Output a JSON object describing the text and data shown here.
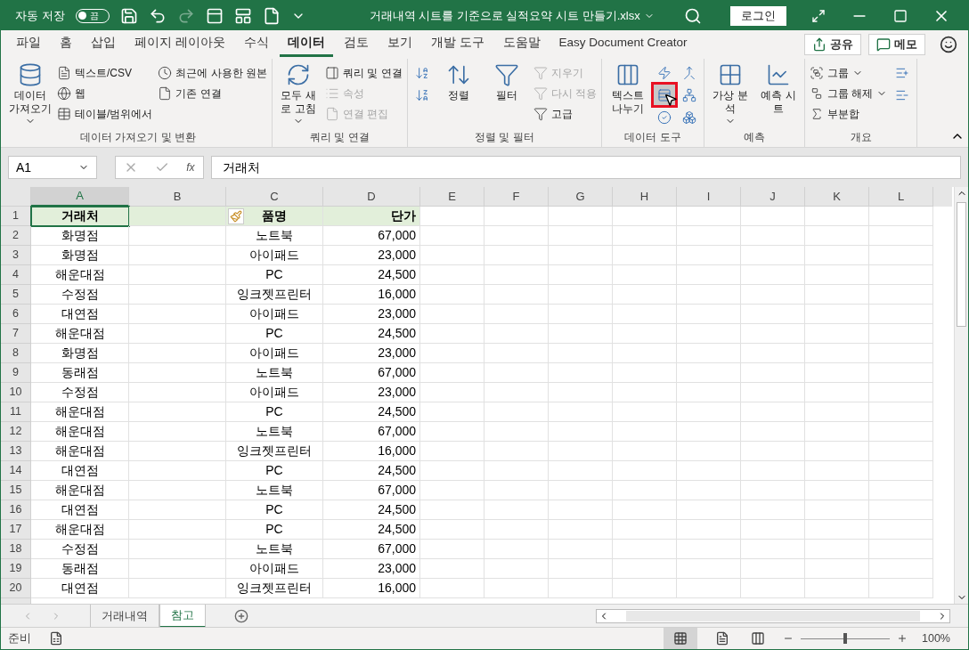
{
  "title_bar": {
    "autosave_label": "자동 저장",
    "autosave_on": false,
    "autosave_state": "끔",
    "title": "거래내역 시트를 기준으로 실적요약 시트 만들기.xlsx",
    "login": "로그인"
  },
  "ribbon_tabs": [
    {
      "label": "파일",
      "selected": false
    },
    {
      "label": "홈",
      "selected": false
    },
    {
      "label": "삽입",
      "selected": false
    },
    {
      "label": "페이지 레이아웃",
      "selected": false
    },
    {
      "label": "수식",
      "selected": false
    },
    {
      "label": "데이터",
      "selected": true
    },
    {
      "label": "검토",
      "selected": false
    },
    {
      "label": "보기",
      "selected": false
    },
    {
      "label": "개발 도구",
      "selected": false
    },
    {
      "label": "도움말",
      "selected": false
    },
    {
      "label": "Easy Document Creator",
      "selected": false
    }
  ],
  "share_button": "공유",
  "memo_button": "메모",
  "ribbon_groups": [
    {
      "label": "데이터 가져오기 및 변환",
      "items": [
        {
          "kind": "large",
          "label": "데이터 가져오기",
          "dropdown": true
        },
        {
          "kind": "column",
          "items": [
            {
              "label": "텍스트/CSV",
              "disabled": false
            },
            {
              "label": "웹",
              "disabled": false
            },
            {
              "label": "테이블/범위에서",
              "disabled": false
            }
          ]
        },
        {
          "kind": "column",
          "items": [
            {
              "label": "최근에 사용한 원본",
              "disabled": false
            },
            {
              "label": "기존 연결",
              "disabled": false
            }
          ]
        }
      ]
    },
    {
      "label": "쿼리 및 연결",
      "items": [
        {
          "kind": "large",
          "label": "모두 새로 고침",
          "dropdown": true
        },
        {
          "kind": "column",
          "items": [
            {
              "label": "쿼리 및 연결",
              "disabled": false
            },
            {
              "label": "속성",
              "disabled": true
            },
            {
              "label": "연결 편집",
              "disabled": true
            }
          ]
        }
      ]
    },
    {
      "label": "정렬 및 필터",
      "items": [
        {
          "kind": "icons",
          "icons": [
            {
              "highlighted": false
            },
            {
              "highlighted": false
            }
          ]
        },
        {
          "kind": "large",
          "label": "정렬",
          "dropdown": false
        },
        {
          "kind": "large",
          "label": "필터",
          "dropdown": false
        },
        {
          "kind": "column",
          "items": [
            {
              "label": "지우기",
              "disabled": true
            },
            {
              "label": "다시 적용",
              "disabled": true
            },
            {
              "label": "고급",
              "disabled": false
            }
          ]
        }
      ]
    },
    {
      "label": "데이터 도구",
      "items": [
        {
          "kind": "large",
          "label": "텍스트 나누기",
          "dropdown": false
        },
        {
          "kind": "icons",
          "icons": [
            {
              "highlighted": false
            },
            {
              "highlighted": true
            },
            {
              "highlighted": false
            }
          ]
        },
        {
          "kind": "icons",
          "icons": [
            {
              "highlighted": false
            },
            {
              "highlighted": false
            },
            {
              "highlighted": false
            }
          ]
        }
      ]
    },
    {
      "label": "예측",
      "items": [
        {
          "kind": "large",
          "label": "가상 분석",
          "dropdown": true
        },
        {
          "kind": "large",
          "label": "예측 시트",
          "dropdown": false
        }
      ]
    },
    {
      "label": "개요",
      "items": [
        {
          "kind": "column",
          "items": [
            {
              "label": "그룹",
              "disabled": false,
              "dropdown": true
            },
            {
              "label": "그룹 해제",
              "disabled": false,
              "dropdown": true
            },
            {
              "label": "부분합",
              "disabled": false,
              "dropdown": false
            }
          ]
        },
        {
          "kind": "icons",
          "icons": [
            {
              "highlighted": false
            },
            {
              "highlighted": false
            }
          ]
        }
      ]
    }
  ],
  "formula_bar": {
    "name_box": "A1",
    "function_label": "fx",
    "formula": "거래처"
  },
  "columns": [
    {
      "label": "A",
      "selected": true
    },
    {
      "label": "B",
      "selected": false
    },
    {
      "label": "C",
      "selected": false
    },
    {
      "label": "D",
      "selected": false
    },
    {
      "label": "E",
      "selected": false
    },
    {
      "label": "F",
      "selected": false
    },
    {
      "label": "G",
      "selected": false
    },
    {
      "label": "H",
      "selected": false
    },
    {
      "label": "I",
      "selected": false
    },
    {
      "label": "J",
      "selected": false
    },
    {
      "label": "K",
      "selected": false
    },
    {
      "label": "L",
      "selected": false
    }
  ],
  "rows": [
    {
      "number": "1",
      "header": true,
      "cells": [
        "거래처",
        "",
        "품명",
        "단가"
      ]
    },
    {
      "number": "2",
      "header": false,
      "cells": [
        "화명점",
        "",
        "노트북",
        "67,000"
      ]
    },
    {
      "number": "3",
      "header": false,
      "cells": [
        "화명점",
        "",
        "아이패드",
        "23,000"
      ]
    },
    {
      "number": "4",
      "header": false,
      "cells": [
        "해운대점",
        "",
        "PC",
        "24,500"
      ]
    },
    {
      "number": "5",
      "header": false,
      "cells": [
        "수정점",
        "",
        "잉크젯프린터",
        "16,000"
      ]
    },
    {
      "number": "6",
      "header": false,
      "cells": [
        "대연점",
        "",
        "아이패드",
        "23,000"
      ]
    },
    {
      "number": "7",
      "header": false,
      "cells": [
        "해운대점",
        "",
        "PC",
        "24,500"
      ]
    },
    {
      "number": "8",
      "header": false,
      "cells": [
        "화명점",
        "",
        "아이패드",
        "23,000"
      ]
    },
    {
      "number": "9",
      "header": false,
      "cells": [
        "동래점",
        "",
        "노트북",
        "67,000"
      ]
    },
    {
      "number": "10",
      "header": false,
      "cells": [
        "수정점",
        "",
        "아이패드",
        "23,000"
      ]
    },
    {
      "number": "11",
      "header": false,
      "cells": [
        "해운대점",
        "",
        "PC",
        "24,500"
      ]
    },
    {
      "number": "12",
      "header": false,
      "cells": [
        "해운대점",
        "",
        "노트북",
        "67,000"
      ]
    },
    {
      "number": "13",
      "header": false,
      "cells": [
        "해운대점",
        "",
        "잉크젯프린터",
        "16,000"
      ]
    },
    {
      "number": "14",
      "header": false,
      "cells": [
        "대연점",
        "",
        "PC",
        "24,500"
      ]
    },
    {
      "number": "15",
      "header": false,
      "cells": [
        "해운대점",
        "",
        "노트북",
        "67,000"
      ]
    },
    {
      "number": "16",
      "header": false,
      "cells": [
        "대연점",
        "",
        "PC",
        "24,500"
      ]
    },
    {
      "number": "17",
      "header": false,
      "cells": [
        "해운대점",
        "",
        "PC",
        "24,500"
      ]
    },
    {
      "number": "18",
      "header": false,
      "cells": [
        "수정점",
        "",
        "노트북",
        "67,000"
      ]
    },
    {
      "number": "19",
      "header": false,
      "cells": [
        "동래점",
        "",
        "아이패드",
        "23,000"
      ]
    },
    {
      "number": "20",
      "header": false,
      "cells": [
        "대연점",
        "",
        "잉크젯프린터",
        "16,000"
      ]
    }
  ],
  "sheet_tabs": [
    {
      "label": "거래내역",
      "selected": false
    },
    {
      "label": "참고",
      "selected": true
    }
  ],
  "status_bar": {
    "status": "준비",
    "zoom": "100%",
    "level": 0.5
  }
}
